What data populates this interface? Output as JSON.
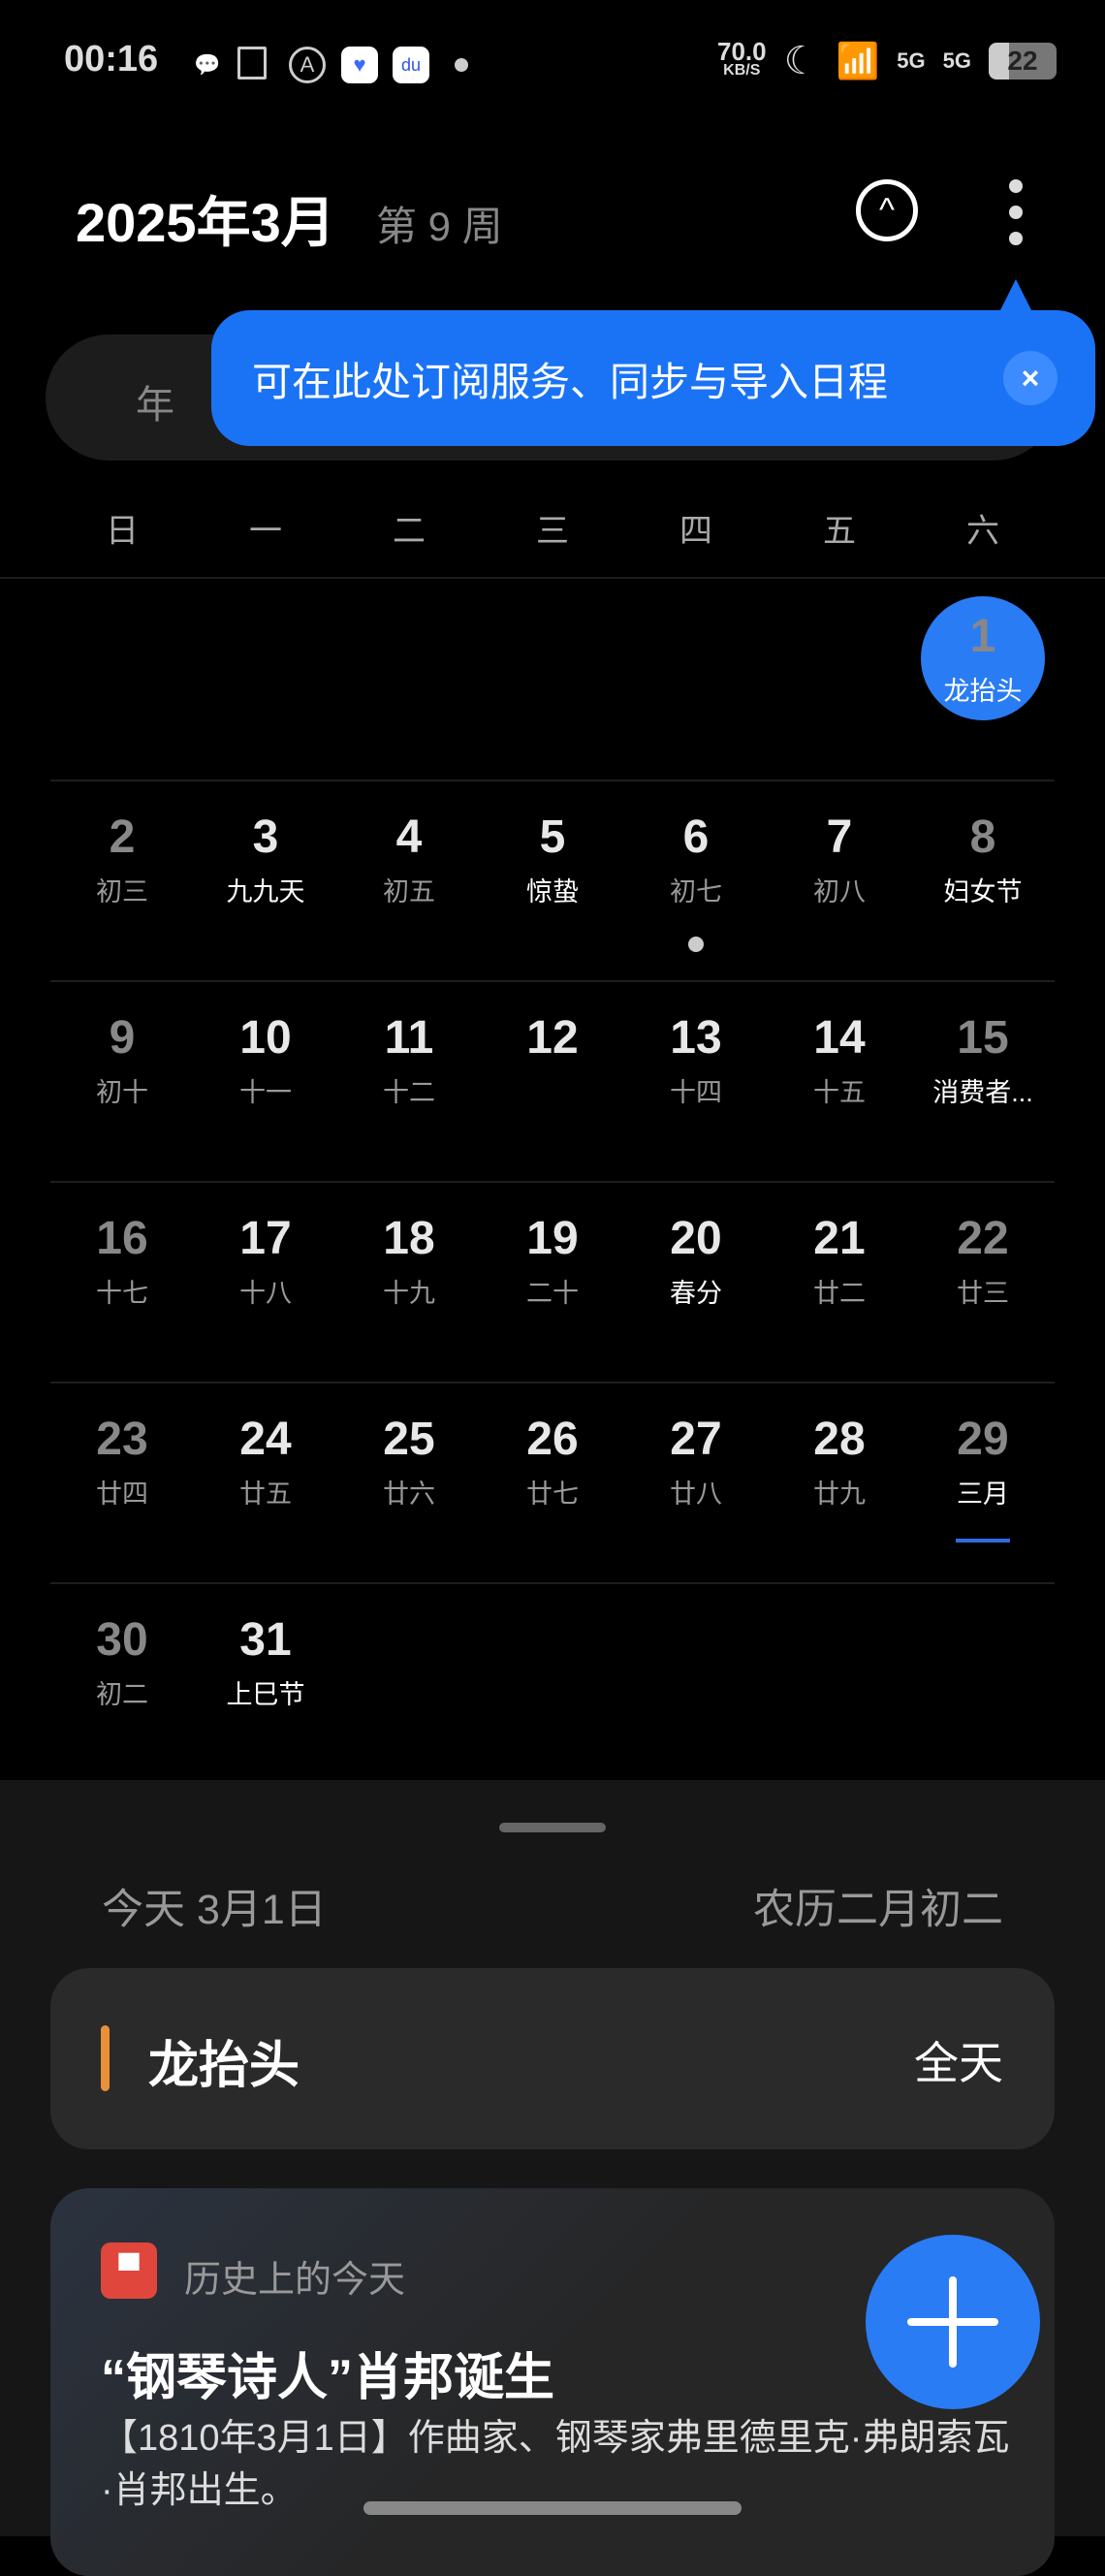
{
  "status": {
    "time": "00:16",
    "speed": "70.0",
    "speed_unit": "KB/S",
    "net1": "5G",
    "net2": "5G",
    "battery": "22"
  },
  "header": {
    "title": "2025年3月",
    "week": "第 9 周"
  },
  "view_tabs": {
    "year": "年"
  },
  "tooltip": {
    "text": "可在此处订阅服务、同步与导入日程",
    "close": "×"
  },
  "weekdays": [
    "日",
    "一",
    "二",
    "三",
    "四",
    "五",
    "六"
  ],
  "weeks": [
    [
      null,
      null,
      null,
      null,
      null,
      null,
      {
        "d": "1",
        "l": "龙抬头",
        "we": true,
        "sel": true,
        "fest": true
      }
    ],
    [
      {
        "d": "2",
        "l": "初三",
        "we": true
      },
      {
        "d": "3",
        "l": "九九天",
        "fest": true
      },
      {
        "d": "4",
        "l": "初五"
      },
      {
        "d": "5",
        "l": "惊蛰",
        "fest": true
      },
      {
        "d": "6",
        "l": "初七",
        "dot": true
      },
      {
        "d": "7",
        "l": "初八"
      },
      {
        "d": "8",
        "l": "妇女节",
        "we": true,
        "fest": true
      }
    ],
    [
      {
        "d": "9",
        "l": "初十",
        "we": true
      },
      {
        "d": "10",
        "l": "十一"
      },
      {
        "d": "11",
        "l": "十二"
      },
      {
        "d": "12",
        "l": ""
      },
      {
        "d": "13",
        "l": "十四"
      },
      {
        "d": "14",
        "l": "十五"
      },
      {
        "d": "15",
        "l": "消费者...",
        "we": true,
        "fest": true
      }
    ],
    [
      {
        "d": "16",
        "l": "十七",
        "we": true
      },
      {
        "d": "17",
        "l": "十八"
      },
      {
        "d": "18",
        "l": "十九"
      },
      {
        "d": "19",
        "l": "二十"
      },
      {
        "d": "20",
        "l": "春分",
        "fest": true
      },
      {
        "d": "21",
        "l": "廿二"
      },
      {
        "d": "22",
        "l": "廿三",
        "we": true
      }
    ],
    [
      {
        "d": "23",
        "l": "廿四",
        "we": true
      },
      {
        "d": "24",
        "l": "廿五"
      },
      {
        "d": "25",
        "l": "廿六"
      },
      {
        "d": "26",
        "l": "廿七"
      },
      {
        "d": "27",
        "l": "廿八"
      },
      {
        "d": "28",
        "l": "廿九"
      },
      {
        "d": "29",
        "l": "三月",
        "we": true,
        "fest": true,
        "uline": true
      }
    ],
    [
      {
        "d": "30",
        "l": "初二",
        "we": true
      },
      {
        "d": "31",
        "l": "上巳节",
        "fest": true
      },
      null,
      null,
      null,
      null,
      null
    ]
  ],
  "today": {
    "date": "今天  3月1日",
    "lunar": "农历二月初二"
  },
  "event": {
    "title": "龙抬头",
    "time": "全天",
    "color": "#e8913a"
  },
  "history": {
    "label": "历史上的今天",
    "title": "“钢琴诗人”肖邦诞生",
    "body": "【1810年3月1日】作曲家、钢琴家弗里德里克·弗朗索瓦·肖邦出生。"
  },
  "colors": {
    "accent": "#2a7cf5",
    "tooltip": "#1a73f5"
  }
}
